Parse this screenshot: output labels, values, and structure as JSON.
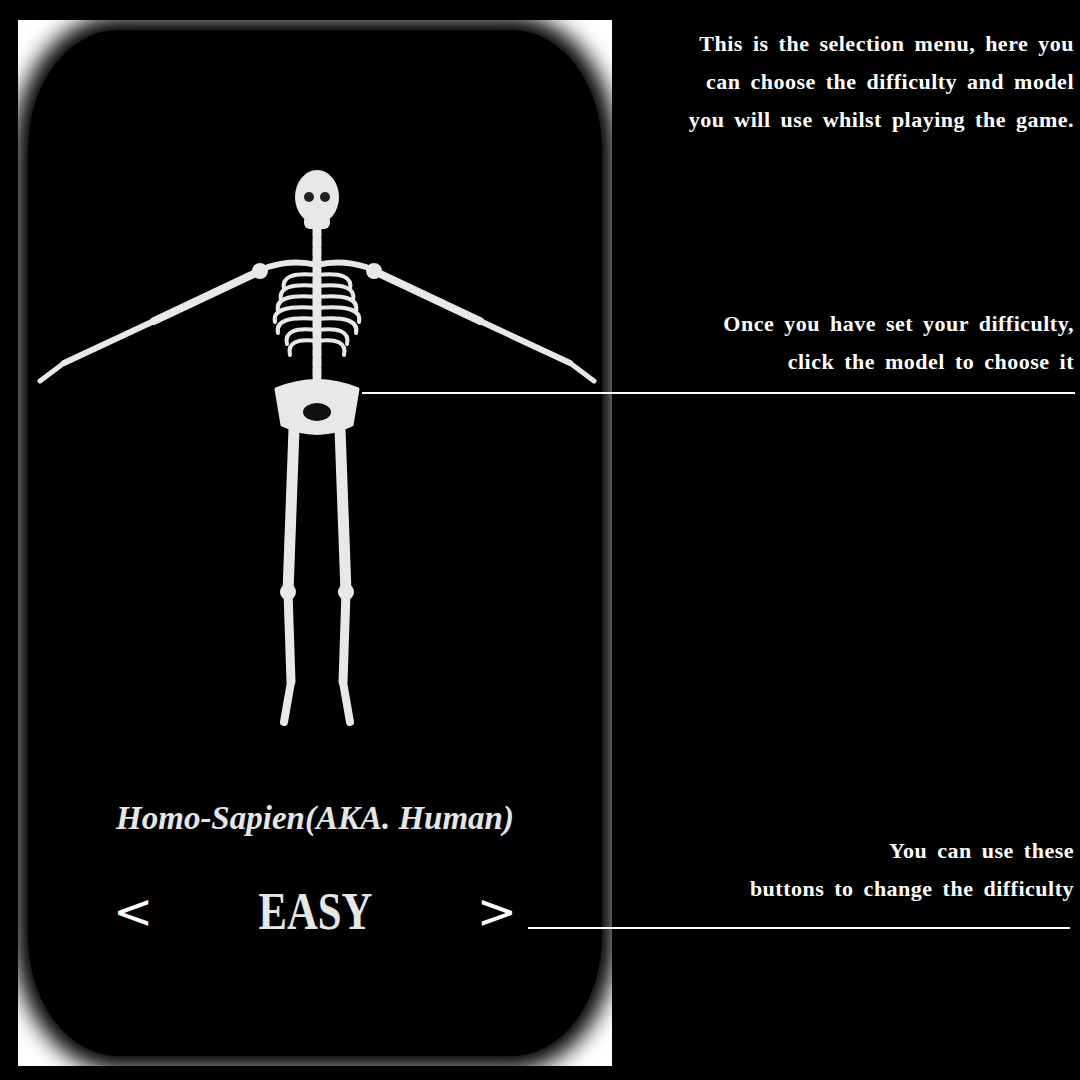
{
  "game_screen": {
    "model_name": "Homo-Sapien(AKA. Human)",
    "difficulty": "EASY",
    "prev_button": "<",
    "next_button": ">"
  },
  "annotations": [
    {
      "lines": [
        "This is the selection menu, here you",
        "can choose the difficulty and model",
        "you will use whilst playing the game."
      ]
    },
    {
      "lines": [
        "Once you have set your difficulty,",
        "click the model to choose it"
      ]
    },
    {
      "lines": [
        "You can use these",
        "buttons to change the difficulty"
      ]
    }
  ]
}
